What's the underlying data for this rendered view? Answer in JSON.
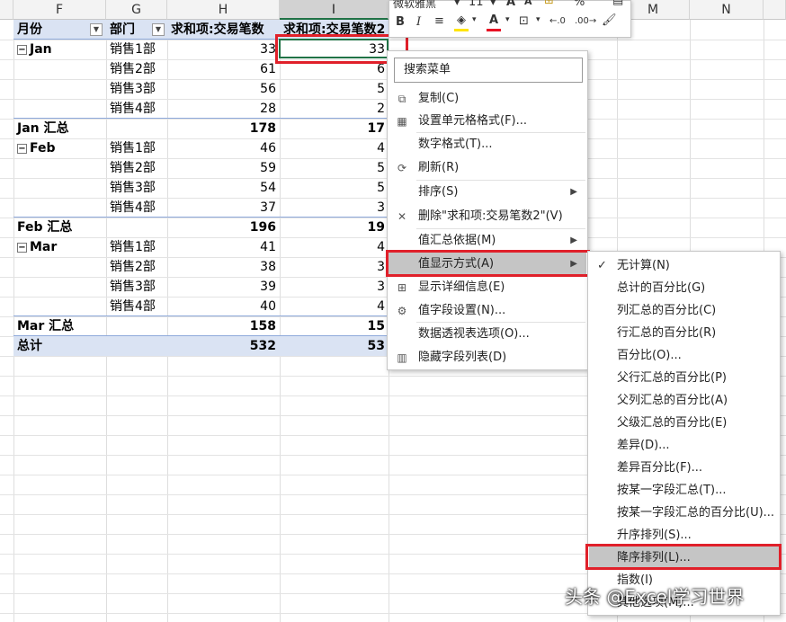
{
  "columns": [
    "F",
    "G",
    "H",
    "I",
    "M",
    "N"
  ],
  "pivot": {
    "headers": [
      "月份",
      "部门",
      "求和项:交易笔数",
      "求和项:交易笔数2"
    ],
    "rows": [
      {
        "month": "Jan",
        "dept": "销售1部",
        "v1": "33",
        "v2": "33"
      },
      {
        "month": "",
        "dept": "销售2部",
        "v1": "61",
        "v2": "6"
      },
      {
        "month": "",
        "dept": "销售3部",
        "v1": "56",
        "v2": "5"
      },
      {
        "month": "",
        "dept": "销售4部",
        "v1": "28",
        "v2": "2"
      },
      {
        "month": "Jan 汇总",
        "dept": "",
        "v1": "178",
        "v2": "17",
        "subtotal": true
      },
      {
        "month": "Feb",
        "dept": "销售1部",
        "v1": "46",
        "v2": "4"
      },
      {
        "month": "",
        "dept": "销售2部",
        "v1": "59",
        "v2": "5"
      },
      {
        "month": "",
        "dept": "销售3部",
        "v1": "54",
        "v2": "5"
      },
      {
        "month": "",
        "dept": "销售4部",
        "v1": "37",
        "v2": "3"
      },
      {
        "month": "Feb 汇总",
        "dept": "",
        "v1": "196",
        "v2": "19",
        "subtotal": true
      },
      {
        "month": "Mar",
        "dept": "销售1部",
        "v1": "41",
        "v2": "4"
      },
      {
        "month": "",
        "dept": "销售2部",
        "v1": "38",
        "v2": "3"
      },
      {
        "month": "",
        "dept": "销售3部",
        "v1": "39",
        "v2": "3"
      },
      {
        "month": "",
        "dept": "销售4部",
        "v1": "40",
        "v2": "4"
      },
      {
        "month": "Mar 汇总",
        "dept": "",
        "v1": "158",
        "v2": "15",
        "subtotal": true
      },
      {
        "month": "总计",
        "dept": "",
        "v1": "532",
        "v2": "53",
        "subtotal": true
      }
    ]
  },
  "mini_toolbar": {
    "font": "微软雅黑",
    "size": "11",
    "bold": "B",
    "italic": "I",
    "percent": "%"
  },
  "context_menu": {
    "search_placeholder": "搜索菜单",
    "items": [
      {
        "label": "复制(C)",
        "icon": "copy-icon"
      },
      {
        "label": "设置单元格格式(F)...",
        "icon": "format-cells-icon"
      },
      {
        "label": "数字格式(T)...",
        "icon": ""
      },
      {
        "label": "刷新(R)",
        "icon": "refresh-icon"
      },
      {
        "label": "排序(S)",
        "icon": "",
        "submenu": true
      },
      {
        "label": "删除\"求和项:交易笔数2\"(V)",
        "icon": "delete-icon"
      },
      {
        "label": "值汇总依据(M)",
        "icon": "",
        "submenu": true
      },
      {
        "label": "值显示方式(A)",
        "icon": "",
        "submenu": true,
        "highlighted": true
      },
      {
        "label": "显示详细信息(E)",
        "icon": "show-details-icon"
      },
      {
        "label": "值字段设置(N)...",
        "icon": "field-settings-icon"
      },
      {
        "label": "数据透视表选项(O)...",
        "icon": ""
      },
      {
        "label": "隐藏字段列表(D)",
        "icon": "field-list-icon"
      }
    ]
  },
  "show_values_submenu": {
    "items": [
      {
        "label": "无计算(N)",
        "checked": true
      },
      {
        "label": "总计的百分比(G)"
      },
      {
        "label": "列汇总的百分比(C)"
      },
      {
        "label": "行汇总的百分比(R)"
      },
      {
        "label": "百分比(O)..."
      },
      {
        "label": "父行汇总的百分比(P)"
      },
      {
        "label": "父列汇总的百分比(A)"
      },
      {
        "label": "父级汇总的百分比(E)"
      },
      {
        "label": "差异(D)..."
      },
      {
        "label": "差异百分比(F)..."
      },
      {
        "label": "按某一字段汇总(T)..."
      },
      {
        "label": "按某一字段汇总的百分比(U)..."
      },
      {
        "label": "升序排列(S)..."
      },
      {
        "label": "降序排列(L)...",
        "highlighted": true
      },
      {
        "label": "指数(I)"
      },
      {
        "label": "其他选项(M)..."
      }
    ]
  },
  "watermark": "头条 @Excel学习世界",
  "colors": {
    "accent": "#217346",
    "highlight_box": "#e0202a",
    "pivot_header": "#dae3f3"
  }
}
